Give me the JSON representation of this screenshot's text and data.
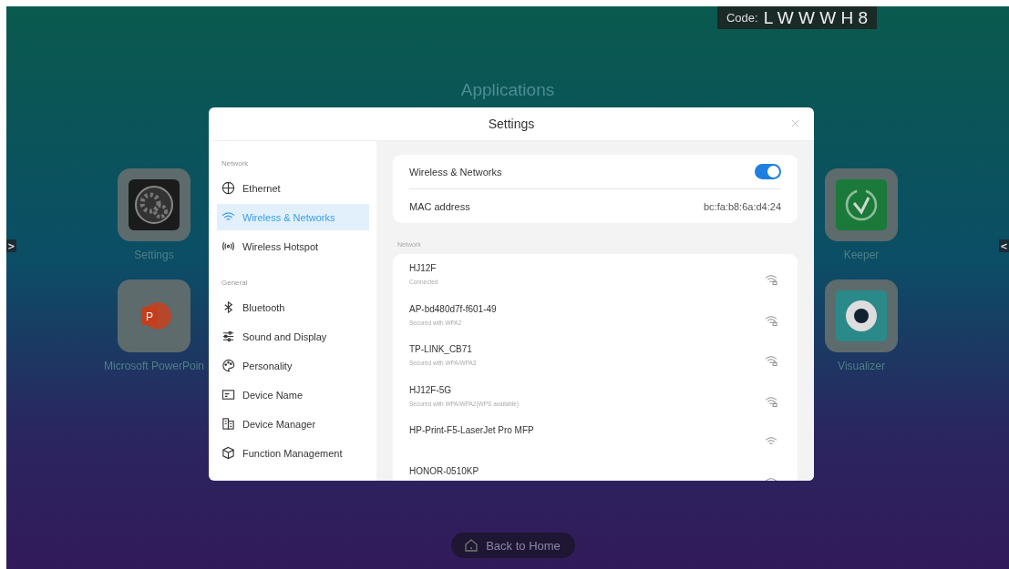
{
  "code_badge": {
    "label": "Code:",
    "value": "L W W W H 8"
  },
  "page_title": "Applications",
  "left_apps": [
    {
      "name": "Settings"
    },
    {
      "name": "Microsoft PowerPoin",
      "icon_letter": "P"
    }
  ],
  "right_apps": [
    {
      "name": "Keeper"
    },
    {
      "name": "Visualizer"
    }
  ],
  "nav_arrows": {
    "left": ">",
    "right": "<"
  },
  "dialog": {
    "title": "Settings",
    "sidebar": [
      {
        "header": "Network",
        "items": [
          {
            "label": "Ethernet",
            "selected": false
          },
          {
            "label": "Wireless & Networks",
            "selected": true
          },
          {
            "label": "Wireless Hotspot",
            "selected": false
          }
        ]
      },
      {
        "header": "General",
        "items": [
          {
            "label": "Bluetooth",
            "selected": false
          },
          {
            "label": "Sound and Display",
            "selected": false
          },
          {
            "label": "Personality",
            "selected": false
          },
          {
            "label": "Device Name",
            "selected": false
          },
          {
            "label": "Device Manager",
            "selected": false
          },
          {
            "label": "Function Management",
            "selected": false
          }
        ]
      }
    ],
    "wireless": {
      "label": "Wireless & Networks",
      "on": true
    },
    "mac": {
      "label": "MAC address",
      "value": "bc:fa:b8:6a:d4:24"
    },
    "network_header": "Network",
    "networks": [
      {
        "name": "HJ12F",
        "status": "Connected",
        "locked": true
      },
      {
        "name": "AP-bd480d7f-f601-49",
        "status": "Secured with WPA2",
        "locked": true
      },
      {
        "name": "TP-LINK_CB71",
        "status": "Secured with WPA/WPA3",
        "locked": true
      },
      {
        "name": "HJ12F-5G",
        "status": "Secured with WPA/WPA2(WPS available)",
        "locked": true
      },
      {
        "name": "HP-Print-F5-LaserJet Pro MFP",
        "locked": false
      },
      {
        "name": "HONOR-0510KP"
      }
    ]
  },
  "home_button": "Back to Home"
}
